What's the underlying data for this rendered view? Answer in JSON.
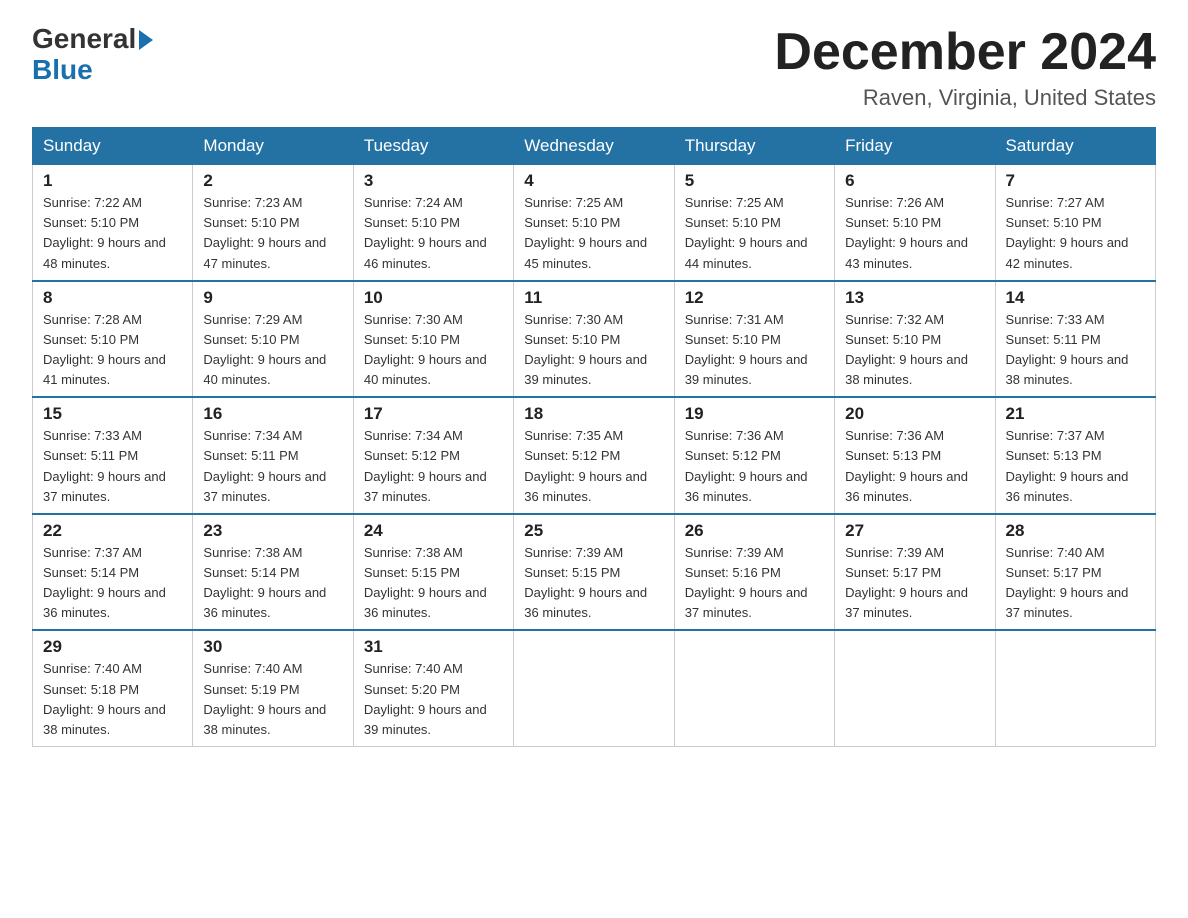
{
  "logo": {
    "line1": "General",
    "line2": "Blue"
  },
  "title": {
    "month": "December 2024",
    "location": "Raven, Virginia, United States"
  },
  "weekdays": [
    "Sunday",
    "Monday",
    "Tuesday",
    "Wednesday",
    "Thursday",
    "Friday",
    "Saturday"
  ],
  "weeks": [
    [
      {
        "day": "1",
        "sunrise": "7:22 AM",
        "sunset": "5:10 PM",
        "daylight": "9 hours and 48 minutes."
      },
      {
        "day": "2",
        "sunrise": "7:23 AM",
        "sunset": "5:10 PM",
        "daylight": "9 hours and 47 minutes."
      },
      {
        "day": "3",
        "sunrise": "7:24 AM",
        "sunset": "5:10 PM",
        "daylight": "9 hours and 46 minutes."
      },
      {
        "day": "4",
        "sunrise": "7:25 AM",
        "sunset": "5:10 PM",
        "daylight": "9 hours and 45 minutes."
      },
      {
        "day": "5",
        "sunrise": "7:25 AM",
        "sunset": "5:10 PM",
        "daylight": "9 hours and 44 minutes."
      },
      {
        "day": "6",
        "sunrise": "7:26 AM",
        "sunset": "5:10 PM",
        "daylight": "9 hours and 43 minutes."
      },
      {
        "day": "7",
        "sunrise": "7:27 AM",
        "sunset": "5:10 PM",
        "daylight": "9 hours and 42 minutes."
      }
    ],
    [
      {
        "day": "8",
        "sunrise": "7:28 AM",
        "sunset": "5:10 PM",
        "daylight": "9 hours and 41 minutes."
      },
      {
        "day": "9",
        "sunrise": "7:29 AM",
        "sunset": "5:10 PM",
        "daylight": "9 hours and 40 minutes."
      },
      {
        "day": "10",
        "sunrise": "7:30 AM",
        "sunset": "5:10 PM",
        "daylight": "9 hours and 40 minutes."
      },
      {
        "day": "11",
        "sunrise": "7:30 AM",
        "sunset": "5:10 PM",
        "daylight": "9 hours and 39 minutes."
      },
      {
        "day": "12",
        "sunrise": "7:31 AM",
        "sunset": "5:10 PM",
        "daylight": "9 hours and 39 minutes."
      },
      {
        "day": "13",
        "sunrise": "7:32 AM",
        "sunset": "5:10 PM",
        "daylight": "9 hours and 38 minutes."
      },
      {
        "day": "14",
        "sunrise": "7:33 AM",
        "sunset": "5:11 PM",
        "daylight": "9 hours and 38 minutes."
      }
    ],
    [
      {
        "day": "15",
        "sunrise": "7:33 AM",
        "sunset": "5:11 PM",
        "daylight": "9 hours and 37 minutes."
      },
      {
        "day": "16",
        "sunrise": "7:34 AM",
        "sunset": "5:11 PM",
        "daylight": "9 hours and 37 minutes."
      },
      {
        "day": "17",
        "sunrise": "7:34 AM",
        "sunset": "5:12 PM",
        "daylight": "9 hours and 37 minutes."
      },
      {
        "day": "18",
        "sunrise": "7:35 AM",
        "sunset": "5:12 PM",
        "daylight": "9 hours and 36 minutes."
      },
      {
        "day": "19",
        "sunrise": "7:36 AM",
        "sunset": "5:12 PM",
        "daylight": "9 hours and 36 minutes."
      },
      {
        "day": "20",
        "sunrise": "7:36 AM",
        "sunset": "5:13 PM",
        "daylight": "9 hours and 36 minutes."
      },
      {
        "day": "21",
        "sunrise": "7:37 AM",
        "sunset": "5:13 PM",
        "daylight": "9 hours and 36 minutes."
      }
    ],
    [
      {
        "day": "22",
        "sunrise": "7:37 AM",
        "sunset": "5:14 PM",
        "daylight": "9 hours and 36 minutes."
      },
      {
        "day": "23",
        "sunrise": "7:38 AM",
        "sunset": "5:14 PM",
        "daylight": "9 hours and 36 minutes."
      },
      {
        "day": "24",
        "sunrise": "7:38 AM",
        "sunset": "5:15 PM",
        "daylight": "9 hours and 36 minutes."
      },
      {
        "day": "25",
        "sunrise": "7:39 AM",
        "sunset": "5:15 PM",
        "daylight": "9 hours and 36 minutes."
      },
      {
        "day": "26",
        "sunrise": "7:39 AM",
        "sunset": "5:16 PM",
        "daylight": "9 hours and 37 minutes."
      },
      {
        "day": "27",
        "sunrise": "7:39 AM",
        "sunset": "5:17 PM",
        "daylight": "9 hours and 37 minutes."
      },
      {
        "day": "28",
        "sunrise": "7:40 AM",
        "sunset": "5:17 PM",
        "daylight": "9 hours and 37 minutes."
      }
    ],
    [
      {
        "day": "29",
        "sunrise": "7:40 AM",
        "sunset": "5:18 PM",
        "daylight": "9 hours and 38 minutes."
      },
      {
        "day": "30",
        "sunrise": "7:40 AM",
        "sunset": "5:19 PM",
        "daylight": "9 hours and 38 minutes."
      },
      {
        "day": "31",
        "sunrise": "7:40 AM",
        "sunset": "5:20 PM",
        "daylight": "9 hours and 39 minutes."
      },
      null,
      null,
      null,
      null
    ]
  ]
}
